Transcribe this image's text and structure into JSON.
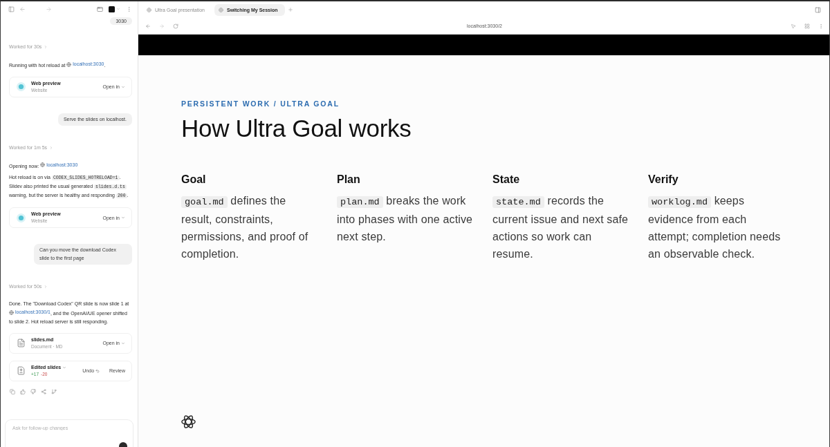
{
  "sidebar": {
    "thread": [
      {
        "kind": "user",
        "text": "3030"
      },
      {
        "kind": "status",
        "text": "Worked for 30s"
      },
      {
        "kind": "paragraph",
        "parts": [
          {
            "kind": "text",
            "text": "Running with hot reload at "
          },
          {
            "kind": "link",
            "text": "localhost:3030"
          },
          {
            "kind": "text",
            "text": "."
          }
        ]
      },
      {
        "kind": "preview",
        "title": "Web preview",
        "subtitle": "Website",
        "action": "Open in"
      },
      {
        "kind": "user",
        "text": "Serve the slides on localhost."
      },
      {
        "kind": "status",
        "text": "Worked for 1m 5s"
      },
      {
        "kind": "paragraph",
        "parts": [
          {
            "kind": "text",
            "text": "Opening now: "
          },
          {
            "kind": "link",
            "text": "localhost:3030"
          }
        ]
      },
      {
        "kind": "paragraph",
        "parts": [
          {
            "kind": "text",
            "text": "Hot reload is on via "
          },
          {
            "kind": "code",
            "text": "CODEX_SLIDES_HOTRELOAD=1"
          },
          {
            "kind": "text",
            "text": ". Slidev also printed the usual generated "
          },
          {
            "kind": "code",
            "text": "slides.d.ts"
          },
          {
            "kind": "text",
            "text": " warning, but the server is healthy and responding "
          },
          {
            "kind": "code",
            "text": "200"
          },
          {
            "kind": "text",
            "text": "."
          }
        ]
      },
      {
        "kind": "preview",
        "title": "Web preview",
        "subtitle": "Website",
        "action": "Open in"
      },
      {
        "kind": "user",
        "text": "Can you move the download Codex slide to the first page"
      },
      {
        "kind": "status",
        "text": "Worked for 50s"
      },
      {
        "kind": "paragraph",
        "parts": [
          {
            "kind": "text",
            "text": "Done. The \"Download Codex\" QR slide is now slide 1 at "
          },
          {
            "kind": "link",
            "text": "localhost:3030/1"
          },
          {
            "kind": "text",
            "text": ", and the OpenAI/UE opener shifted to slide 2. Hot reload server is still responding."
          }
        ]
      },
      {
        "kind": "file",
        "title": "slides.md",
        "subtitle": "Document · MD",
        "action": "Open in"
      },
      {
        "kind": "diff",
        "title": "Edited slides",
        "added": "+17",
        "removed": "-20",
        "buttons": [
          {
            "kind": "undo",
            "label": "Undo"
          },
          {
            "kind": "review",
            "label": "Review"
          }
        ]
      },
      {
        "kind": "actions"
      }
    ],
    "composer": {
      "placeholder": "Ask for follow-up changes"
    }
  },
  "browser": {
    "tabs": [
      {
        "label": "Ultra Goal presentation",
        "selected": false
      },
      {
        "label": "Switching My Session",
        "selected": true
      }
    ],
    "address": "localhost:3030/2"
  },
  "slide": {
    "kicker": "PERSISTENT WORK / ULTRA GOAL",
    "title": "How Ultra Goal works",
    "columns": [
      {
        "title": "Goal",
        "code": "goal.md",
        "text": "defines the result, constraints, permissions, and proof of completion."
      },
      {
        "title": "Plan",
        "code": "plan.md",
        "text": "breaks the work into phases with one active next step."
      },
      {
        "title": "State",
        "code": "state.md",
        "text": "records the current issue and next safe actions so work can resume."
      },
      {
        "title": "Verify",
        "code": "worklog.md",
        "text": "keeps evidence from each attempt; completion needs an observable check."
      }
    ]
  }
}
